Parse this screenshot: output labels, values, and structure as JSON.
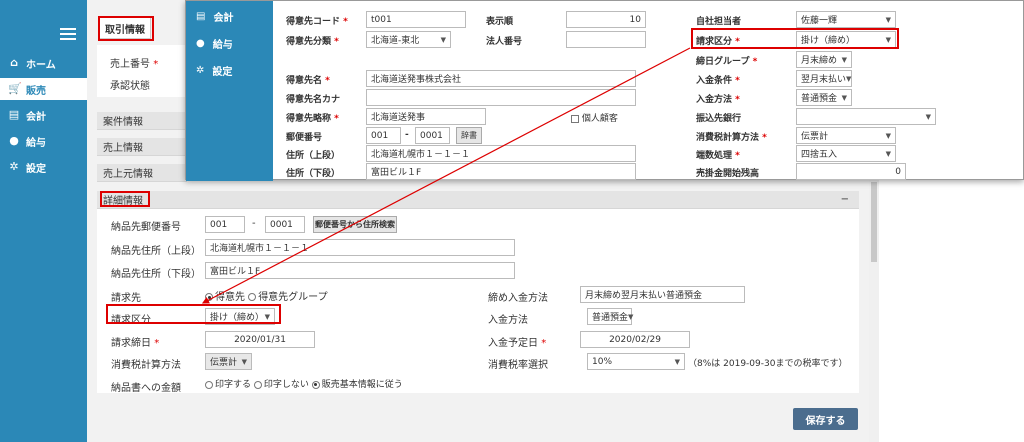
{
  "sidebar": {
    "items": [
      {
        "label": "ホーム",
        "icon": "home-icon"
      },
      {
        "label": "販売",
        "icon": "cart-icon"
      },
      {
        "label": "会計",
        "icon": "ledger-icon"
      },
      {
        "label": "給与",
        "icon": "money-bag-icon"
      },
      {
        "label": "設定",
        "icon": "gear-icon"
      }
    ]
  },
  "tabs": {
    "trade_info": "取引情報"
  },
  "main": {
    "sales_no_label": "売上番号",
    "approval_label": "承認状態",
    "project_info": "案件情報",
    "sales_info": "売上情報",
    "sales_source_info": "売上元情報",
    "detail_info": "詳細情報",
    "collapse": "−"
  },
  "detail": {
    "postal_label": "納品先郵便番号",
    "postal1": "001",
    "postal_sep": "-",
    "postal2": "0001",
    "postal_search": "郵便番号から住所検索",
    "addr_upper_label": "納品先住所（上段）",
    "addr_upper": "北海道札幌市１－１－１",
    "addr_lower_label": "納品先住所（下段）",
    "addr_lower": "富田ビル１F",
    "billing_label": "請求先",
    "billing_opt1": "得意先",
    "billing_opt2": "得意先グループ",
    "closing_label": "締め入金方法",
    "closing_value": "月末締め翌月末払い普通預金",
    "billing_type_label": "請求区分",
    "billing_type_value": "掛け（締め）",
    "payment_method_label": "入金方法",
    "payment_method_value": "普通預金",
    "billing_date_label": "請求締日",
    "billing_date_value": "2020/01/31",
    "payment_date_label": "入金予定日",
    "payment_date_value": "2020/02/29",
    "tax_calc_label": "消費税計算方法",
    "tax_calc_value": "伝票計",
    "tax_rate_label": "消費税率選択",
    "tax_rate_value": "10%",
    "tax_rate_note": "（8%は 2019-09-30までの税率です）",
    "print_amount_label": "納品書への金額",
    "print_opt1": "印字する",
    "print_opt2": "印字しない",
    "print_opt3": "販売基本情報に従う",
    "save": "保存する"
  },
  "popup": {
    "side": [
      {
        "label": "会計",
        "icon": "ledger-icon"
      },
      {
        "label": "給与",
        "icon": "money-bag-icon"
      },
      {
        "label": "設定",
        "icon": "gear-icon"
      }
    ],
    "customer_code_label": "得意先コード",
    "customer_code": "t001",
    "display_order_label": "表示順",
    "display_order": "10",
    "staff_label": "自社担当者",
    "staff_value": "佐藤一輝",
    "customer_class_label": "得意先分類",
    "customer_class_value": "北海道-東北",
    "corp_no_label": "法人番号",
    "corp_no_value": "",
    "billing_type_label": "請求区分",
    "billing_type_value": "掛け（締め）",
    "closing_group_label": "締日グループ",
    "closing_group_value": "月末締め",
    "customer_name_label": "得意先名",
    "customer_name": "北海道送発事株式会社",
    "pay_terms_label": "入金条件",
    "pay_terms_value": "翌月末払い",
    "customer_kana_label": "得意先名カナ",
    "customer_kana": "",
    "pay_method_label": "入金方法",
    "pay_method_value": "普通預金",
    "customer_short_label": "得意先略称",
    "customer_short": "北海道送発事",
    "individual_label": "個人顧客",
    "transfer_bank_label": "振込先銀行",
    "transfer_bank_value": "",
    "postal_label": "郵便番号",
    "postal1": "001",
    "postal_sep": "-",
    "postal2": "0001",
    "dict_btn": "辞書",
    "tax_calc_label": "消費税計算方法",
    "tax_calc_value": "伝票計",
    "addr_upper_label": "住所（上段）",
    "addr_upper": "北海道札幌市１－１－１",
    "rounding_label": "端数処理",
    "rounding_value": "四捨五入",
    "addr_lower_label": "住所（下段）",
    "addr_lower": "富田ビル１F",
    "ar_start_label": "売掛金開始残高",
    "ar_start_value": "0",
    "req_mark": "*"
  },
  "colors": {
    "sidebar": "#2b88b7",
    "highlight": "#dd0000",
    "save_button": "#4b6d8e"
  }
}
